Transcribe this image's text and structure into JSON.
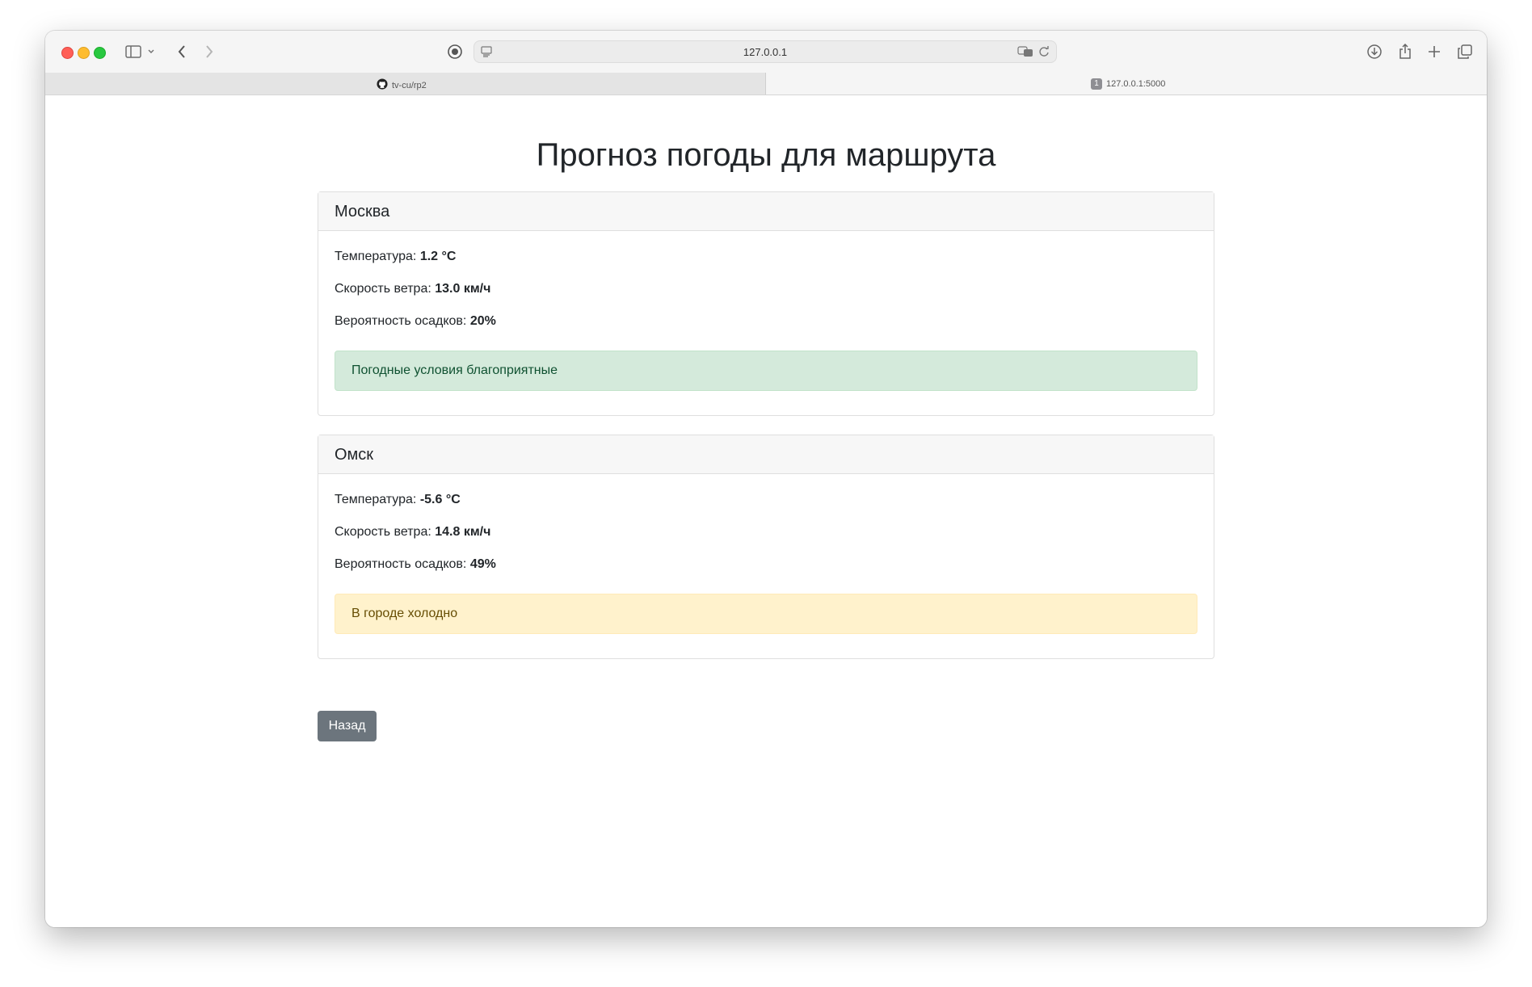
{
  "browser": {
    "address": "127.0.0.1",
    "tabs": [
      {
        "label": "tv-cu/rp2",
        "icon": "github-icon",
        "active": true
      },
      {
        "label": "127.0.0.1:5000",
        "badge": "1",
        "active": false
      }
    ]
  },
  "page": {
    "title": "Прогноз погоды для маршрута",
    "back_label": "Назад",
    "cities": [
      {
        "name": "Москва",
        "temp_label": "Температура:",
        "temp_value": "1.2 °C",
        "wind_label": "Скорость ветра:",
        "wind_value": "13.0 км/ч",
        "precip_label": "Вероятность осадков:",
        "precip_value": "20%",
        "status": "Погодные условия благоприятные",
        "status_type": "success"
      },
      {
        "name": "Омск",
        "temp_label": "Температура:",
        "temp_value": "-5.6 °C",
        "wind_label": "Скорость ветра:",
        "wind_value": "14.8 км/ч",
        "precip_label": "Вероятность осадков:",
        "precip_value": "49%",
        "status": "В городе холодно",
        "status_type": "warning"
      }
    ]
  },
  "colors": {
    "success_bg": "#d4eadb",
    "warning_bg": "#fff2cc",
    "button_bg": "#6c757d"
  }
}
